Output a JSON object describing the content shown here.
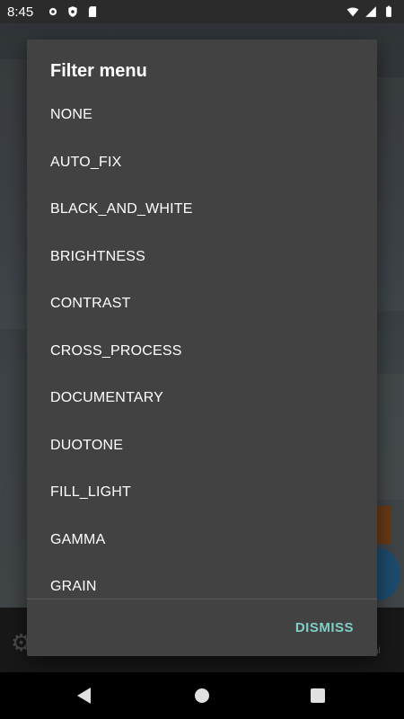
{
  "status_bar": {
    "time": "8:45",
    "left_icons": [
      "gear-icon",
      "shield-icon",
      "sd-card-icon"
    ],
    "right_icons": [
      "wifi-icon",
      "cell-signal-icon",
      "battery-icon"
    ]
  },
  "dialog": {
    "title": "Filter menu",
    "items": [
      "NONE",
      "AUTO_FIX",
      "BLACK_AND_WHITE",
      "BRIGHTNESS",
      "CONTRAST",
      "CROSS_PROCESS",
      "DOCUMENTARY",
      "DUOTONE",
      "FILL_LIGHT",
      "GAMMA",
      "GRAIN"
    ],
    "dismiss_label": "DISMISS"
  },
  "colors": {
    "dialog_bg": "#424242",
    "accent": "#7fcfc6"
  },
  "nav_bar": {
    "buttons": [
      "back-icon",
      "home-icon",
      "recents-icon"
    ]
  }
}
